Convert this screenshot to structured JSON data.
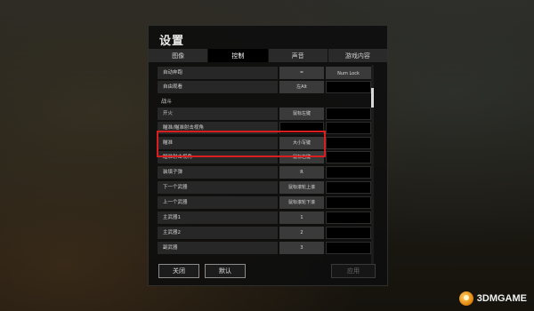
{
  "window": {
    "title": "设置"
  },
  "tabs": [
    {
      "label": "图像",
      "active": false
    },
    {
      "label": "控制",
      "active": true
    },
    {
      "label": "声音",
      "active": false
    },
    {
      "label": "游戏内容",
      "active": false
    }
  ],
  "section": {
    "label": "战斗"
  },
  "rows": [
    {
      "label": "自动奔跑",
      "key1": "=",
      "key2": "Num Lock"
    },
    {
      "label": "自由观看",
      "key1": "左Alt",
      "key2": ""
    },
    {
      "label": "开火",
      "key1": "鼠标左键",
      "key2": ""
    },
    {
      "label": "瞄准/瞄准射击视角",
      "key1": "",
      "key2": ""
    },
    {
      "label": "瞄准",
      "key1": "大小写键",
      "key2": ""
    },
    {
      "label": "瞄准射击视角",
      "key1": "鼠标右键",
      "key2": ""
    },
    {
      "label": "装填子弹",
      "key1": "R",
      "key2": ""
    },
    {
      "label": "下一个武器",
      "key1": "鼠标滚轮上滚",
      "key2": ""
    },
    {
      "label": "上一个武器",
      "key1": "鼠标滚轮下滚",
      "key2": ""
    },
    {
      "label": "主武器1",
      "key1": "1",
      "key2": ""
    },
    {
      "label": "主武器2",
      "key1": "2",
      "key2": ""
    },
    {
      "label": "副武器",
      "key1": "3",
      "key2": ""
    }
  ],
  "footer": {
    "close_label": "关闭",
    "default_label": "默认",
    "apply_label": "应用"
  },
  "watermark": {
    "text": "3DMGAME"
  },
  "colors": {
    "highlight": "#d81e1e",
    "active_tab": "#000000"
  }
}
